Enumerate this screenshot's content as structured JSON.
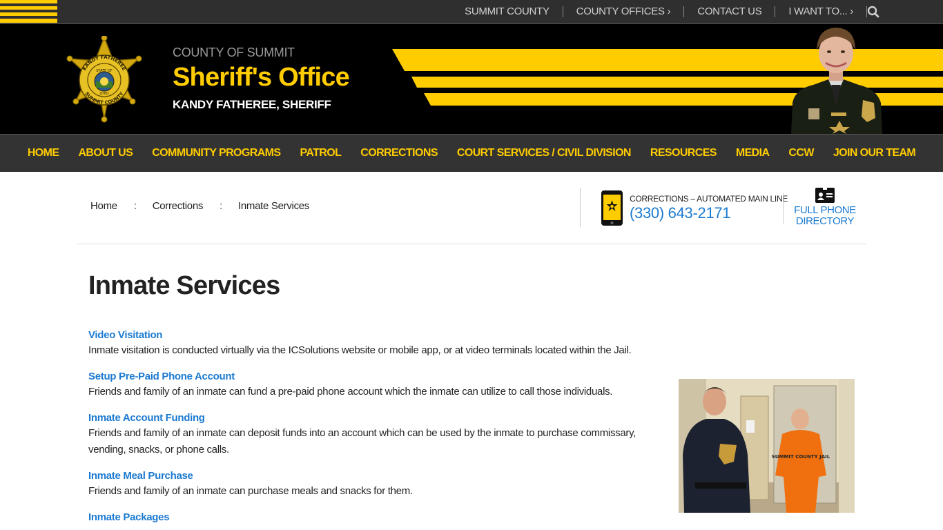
{
  "utility_nav": {
    "items": [
      {
        "label": "SUMMIT COUNTY"
      },
      {
        "label": "COUNTY OFFICES ›"
      },
      {
        "label": "CONTACT US"
      },
      {
        "label": "I WANT TO... ›"
      }
    ],
    "search_icon": "search-icon"
  },
  "header": {
    "county": "COUNTY OF SUMMIT",
    "title": "Sheriff's Office",
    "sheriff": "KANDY FATHEREE, SHERIFF",
    "badge": {
      "top_text": "KANDY FATHEREE",
      "bottom_text": "SUMMIT COUNTY",
      "inner_top": "STATE OF",
      "inner_bottom": "OHIO"
    }
  },
  "main_nav": [
    "HOME",
    "ABOUT US",
    "COMMUNITY PROGRAMS",
    "PATROL",
    "CORRECTIONS",
    "COURT SERVICES / CIVIL DIVISION",
    "RESOURCES",
    "MEDIA",
    "CCW",
    "JOIN OUR TEAM"
  ],
  "breadcrumb": {
    "items": [
      "Home",
      "Corrections",
      "Inmate Services"
    ],
    "separator": ":"
  },
  "contact": {
    "label": "CORRECTIONS – AUTOMATED MAIN LINE",
    "phone": "(330) 643-2171",
    "directory_label": "FULL PHONE DIRECTORY"
  },
  "page": {
    "title": "Inmate Services",
    "services": [
      {
        "title": "Video Visitation",
        "description": "Inmate visitation is conducted virtually via the ICSolutions website or mobile app, or at video terminals located within the Jail."
      },
      {
        "title": "Setup Pre-Paid Phone Account",
        "description": "Friends and family of an inmate can fund a pre-paid phone account which the inmate can utilize to call those individuals."
      },
      {
        "title": "Inmate Account Funding",
        "description": "Friends and family of an inmate can deposit funds into an account which can be used by the inmate to purchase commissary, vending, snacks, or phone calls."
      },
      {
        "title": "Inmate Meal Purchase",
        "description": "Friends and family of an inmate can purchase meals and snacks for them."
      },
      {
        "title": "Inmate Packages",
        "description": ""
      }
    ],
    "photo": {
      "jumpsuit_text": "SUMMIT COUNTY JAIL"
    }
  },
  "colors": {
    "accent_yellow": "#ffcc00",
    "link_blue": "#1b7ad1",
    "nav_bg": "#333333",
    "header_bg": "#000000"
  }
}
